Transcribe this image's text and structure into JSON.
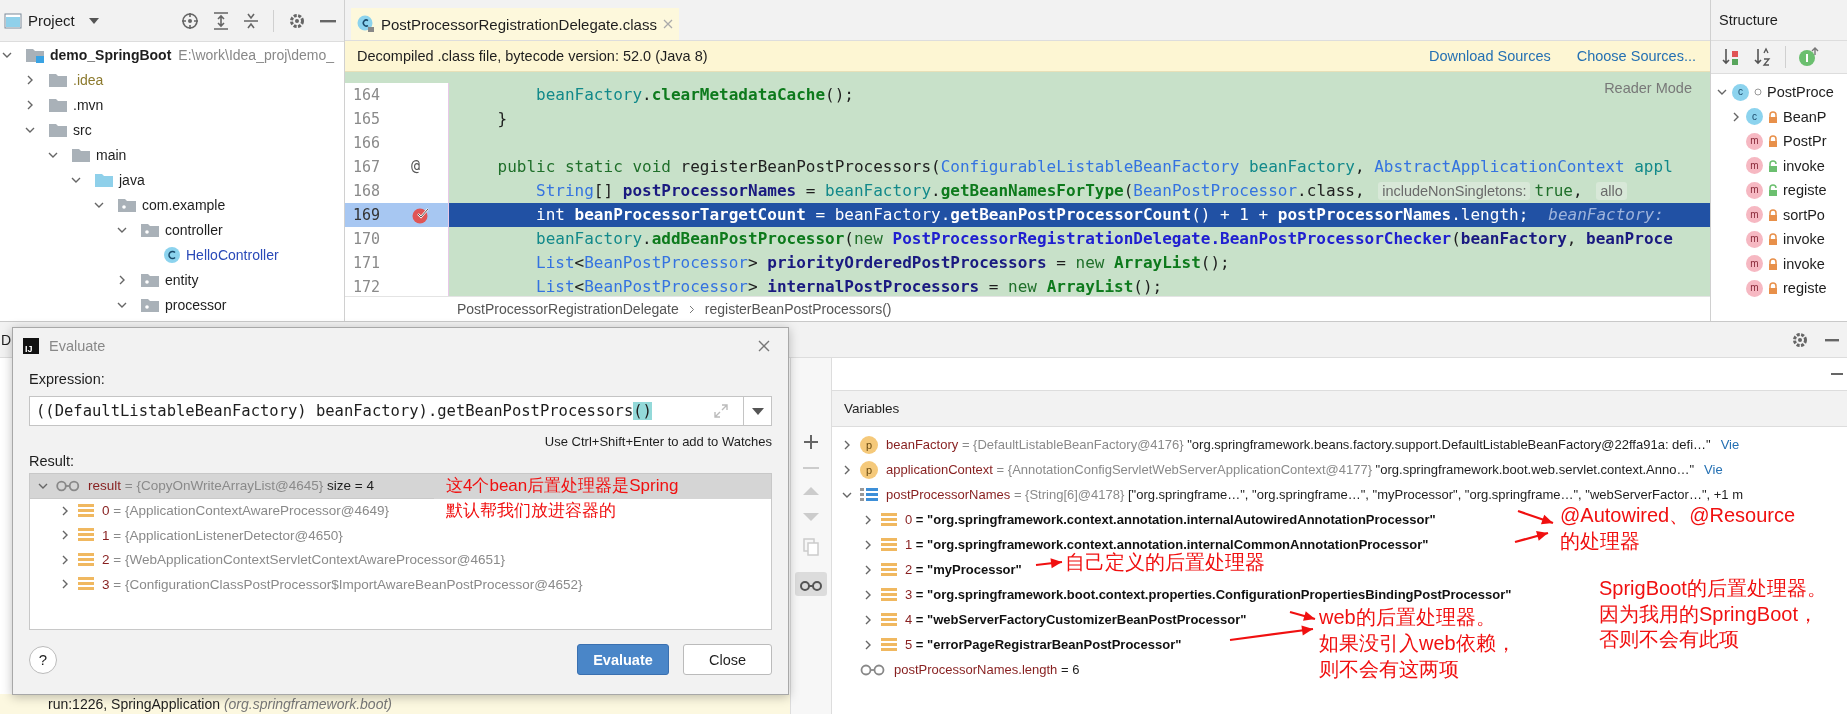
{
  "project_panel": {
    "title": "Project",
    "tree": [
      {
        "label": "demo_SpringBoot",
        "path": "E:\\work\\Idea_proj\\demo_",
        "kind": "module",
        "expanded": true,
        "children": [
          {
            "label": ".idea",
            "kind": "excluded",
            "expanded": false
          },
          {
            "label": ".mvn",
            "kind": "folder",
            "expanded": false
          },
          {
            "label": "src",
            "kind": "folder",
            "expanded": true,
            "children": [
              {
                "label": "main",
                "kind": "folder",
                "expanded": true,
                "children": [
                  {
                    "label": "java",
                    "kind": "source",
                    "expanded": true,
                    "children": [
                      {
                        "label": "com.example",
                        "kind": "package",
                        "expanded": true,
                        "children": [
                          {
                            "label": "controller",
                            "kind": "package",
                            "expanded": true,
                            "children": [
                              {
                                "label": "HelloController",
                                "kind": "class"
                              }
                            ]
                          },
                          {
                            "label": "entity",
                            "kind": "package",
                            "expanded": false
                          },
                          {
                            "label": "processor",
                            "kind": "package",
                            "expanded": true
                          }
                        ]
                      }
                    ]
                  }
                ]
              }
            ]
          }
        ]
      }
    ]
  },
  "editor": {
    "tabs": [
      {
        "label": "PostProcessorRegistrationDelegate.class",
        "selected": true
      }
    ],
    "banner": {
      "text": "Decompiled .class file, bytecode version: 52.0 (Java 8)",
      "links": [
        "Download Sources",
        "Choose Sources..."
      ]
    },
    "reader_mode": "Reader Mode",
    "lines": [
      {
        "number": "164",
        "kind": "statement",
        "selected": false,
        "breakpoint": false,
        "tokens": [
          {
            "kind": "field",
            "text": "beanFactory"
          },
          {
            "kind": "plain",
            "text": "."
          },
          {
            "kind": "method",
            "text": "clearMetadataCache"
          },
          {
            "kind": "plain",
            "text": "();"
          }
        ]
      },
      {
        "number": "165",
        "kind": "member",
        "selected": false,
        "breakpoint": false,
        "tokens": [
          {
            "kind": "plain",
            "text": "}"
          }
        ]
      },
      {
        "number": "166",
        "kind": "blank",
        "selected": false,
        "breakpoint": false
      },
      {
        "number": "167",
        "kind": "member",
        "selected": false,
        "breakpoint": false,
        "gutter_text": "@",
        "tokens": [
          {
            "kind": "keyword",
            "text": "public static void "
          },
          {
            "kind": "plain",
            "text": "registerBeanPostProcessors("
          },
          {
            "kind": "type",
            "text": "ConfigurableListableBeanFactory "
          },
          {
            "kind": "field",
            "text": "beanFactory"
          },
          {
            "kind": "plain",
            "text": ", "
          },
          {
            "kind": "type",
            "text": "AbstractApplicationContext "
          },
          {
            "kind": "field",
            "text": "appl"
          }
        ]
      },
      {
        "number": "168",
        "kind": "statement",
        "selected": false,
        "breakpoint": false,
        "tokens": [
          {
            "kind": "type",
            "text": "String"
          },
          {
            "kind": "plain",
            "text": "[] "
          },
          {
            "kind": "variable",
            "text": "postProcessorNames"
          },
          {
            "kind": "plain",
            "text": " = "
          },
          {
            "kind": "field",
            "text": "beanFactory"
          },
          {
            "kind": "plain",
            "text": "."
          },
          {
            "kind": "method",
            "text": "getBeanNamesForType"
          },
          {
            "kind": "plain",
            "text": "("
          },
          {
            "kind": "type",
            "text": "BeanPostProcessor"
          },
          {
            "kind": "plain",
            "text": ".class, "
          },
          {
            "kind": "hint",
            "text": "includeNonSingletons:"
          },
          {
            "kind": "keyword",
            "text": "true"
          },
          {
            "kind": "plain",
            "text": ", "
          },
          {
            "kind": "hint",
            "text": "allo"
          }
        ]
      },
      {
        "number": "169",
        "kind": "statement",
        "selected": true,
        "breakpoint": true,
        "tokens": [
          {
            "kind": "keyword",
            "text": "int "
          },
          {
            "kind": "variable",
            "text": "beanProcessorTargetCount"
          },
          {
            "kind": "plain",
            "text": " = "
          },
          {
            "kind": "field",
            "text": "beanFactory"
          },
          {
            "kind": "plain",
            "text": "."
          },
          {
            "kind": "method",
            "text": "getBeanPostProcessorCount"
          },
          {
            "kind": "plain",
            "text": "() + 1 + "
          },
          {
            "kind": "variable",
            "text": "postProcessorNames"
          },
          {
            "kind": "plain",
            "text": ".length;"
          },
          {
            "kind": "inline",
            "text": "beanFactory:"
          }
        ]
      },
      {
        "number": "170",
        "kind": "statement",
        "selected": false,
        "breakpoint": false,
        "tokens": [
          {
            "kind": "field",
            "text": "beanFactory"
          },
          {
            "kind": "plain",
            "text": "."
          },
          {
            "kind": "method",
            "text": "addBeanPostProcessor"
          },
          {
            "kind": "plain",
            "text": "("
          },
          {
            "kind": "keyword",
            "text": "new "
          },
          {
            "kind": "classref",
            "text": "PostProcessorRegistrationDelegate.BeanPostProcessorChecker"
          },
          {
            "kind": "plain",
            "text": "("
          },
          {
            "kind": "variable",
            "text": "beanFactory"
          },
          {
            "kind": "plain",
            "text": ", "
          },
          {
            "kind": "variable",
            "text": "beanProce"
          }
        ]
      },
      {
        "number": "171",
        "kind": "statement",
        "selected": false,
        "breakpoint": false,
        "tokens": [
          {
            "kind": "type",
            "text": "List"
          },
          {
            "kind": "plain",
            "text": "<"
          },
          {
            "kind": "type",
            "text": "BeanPostProcessor"
          },
          {
            "kind": "plain",
            "text": "> "
          },
          {
            "kind": "variable",
            "text": "priorityOrderedPostProcessors"
          },
          {
            "kind": "plain",
            "text": " = "
          },
          {
            "kind": "keyword",
            "text": "new "
          },
          {
            "kind": "method",
            "text": "ArrayList"
          },
          {
            "kind": "plain",
            "text": "();"
          }
        ]
      },
      {
        "number": "172",
        "kind": "statement",
        "selected": false,
        "breakpoint": false,
        "tokens": [
          {
            "kind": "type",
            "text": "List"
          },
          {
            "kind": "plain",
            "text": "<"
          },
          {
            "kind": "type",
            "text": "BeanPostProcessor"
          },
          {
            "kind": "plain",
            "text": "> "
          },
          {
            "kind": "variable",
            "text": "internalPostProcessors"
          },
          {
            "kind": "plain",
            "text": " = "
          },
          {
            "kind": "keyword",
            "text": "new "
          },
          {
            "kind": "method",
            "text": "ArrayList"
          },
          {
            "kind": "plain",
            "text": "();"
          }
        ]
      }
    ],
    "breadcrumb": [
      "PostProcessorRegistrationDelegate",
      "registerBeanPostProcessors()"
    ]
  },
  "structure_panel": {
    "title": "Structure",
    "tree": [
      {
        "label": "PostProce",
        "icon": "c",
        "expanded": true,
        "children": [
          {
            "label": "BeanP",
            "icon": "c",
            "private": true,
            "expanded": false
          },
          {
            "label": "PostPr",
            "icon": "m",
            "private": true
          },
          {
            "label": "invoke",
            "icon": "m",
            "private": false
          },
          {
            "label": "registe",
            "icon": "m",
            "private": false
          },
          {
            "label": "sortPo",
            "icon": "m",
            "private": true
          },
          {
            "label": "invoke",
            "icon": "m",
            "private": true
          },
          {
            "label": "invoke",
            "icon": "m",
            "private": true
          },
          {
            "label": "registe",
            "icon": "m",
            "private": true
          }
        ]
      }
    ]
  },
  "debug_panel": {
    "tab": "D",
    "frame": {
      "text": "run:1226, SpringApplication",
      "package": "(org.springframework.boot)"
    }
  },
  "evaluate_dialog": {
    "app_icon": "IJ",
    "title": "Evaluate",
    "expression_label": "Expression:",
    "expression": "((DefaultListableBeanFactory) beanFactory).getBeanPostProcessors()",
    "bracket_highlight": true,
    "watch_hint": "Use Ctrl+Shift+Enter to add to Watches",
    "result_label": "Result:",
    "result": {
      "name": "result",
      "detail": "= {CopyOnWriteArrayList@4645}",
      "extra": "size = 4",
      "expanded": true,
      "selected": true,
      "children": [
        {
          "name": "0",
          "detail": "= {ApplicationContextAwareProcessor@4649}",
          "expanded": false,
          "selected": false
        },
        {
          "name": "1",
          "detail": "= {ApplicationListenerDetector@4650}",
          "expanded": false,
          "selected": false
        },
        {
          "name": "2",
          "detail": "= {WebApplicationContextServletContextAwareProcessor@4651}",
          "expanded": false,
          "selected": false
        },
        {
          "name": "3",
          "detail": "= {ConfigurationClassPostProcessor$ImportAwareBeanPostProcessor@4652}",
          "expanded": false,
          "selected": false
        }
      ]
    },
    "note_lines": [
      "这4个bean后置处理器是Spring",
      "默认帮我们放进容器的"
    ],
    "help": "?",
    "buttons": [
      {
        "label": "Evaluate",
        "kind": "primary"
      },
      {
        "label": "Close",
        "kind": "secondary"
      }
    ]
  },
  "variables_panel": {
    "title": "Variables",
    "rows": [
      {
        "kind": "parameter",
        "icon": "p",
        "name": "beanFactory",
        "expanded": false,
        "type": "= {DefaultListableBeanFactory@4176}",
        "value": "\"org.springframework.beans.factory.support.DefaultListableBeanFactory@22ffa91a: defi…\"",
        "link": "Vie"
      },
      {
        "kind": "parameter",
        "icon": "p",
        "name": "applicationContext",
        "expanded": false,
        "type": "= {AnnotationConfigServletWebServerApplicationContext@4177}",
        "value": "\"org.springframework.boot.web.servlet.context.Anno…\"",
        "link": "Vie"
      },
      {
        "kind": "array",
        "name": "postProcessorNames",
        "expanded": true,
        "type": "= {String[6]@4178}",
        "value": "[\"org.springframe…\", \"org.springframe…\", \"myProcessor\", \"org.springframe…\", \"webServerFactor…\", +1 m",
        "children": [
          {
            "name": "0",
            "value": "= \"org.springframework.context.annotation.internalAutowiredAnnotationProcessor\"",
            "expanded": false
          },
          {
            "name": "1",
            "value": "= \"org.springframework.context.annotation.internalCommonAnnotationProcessor\"",
            "expanded": false
          },
          {
            "name": "2",
            "value": "= \"myProcessor\"",
            "expanded": false
          },
          {
            "name": "3",
            "value": "= \"org.springframework.boot.context.properties.ConfigurationPropertiesBindingPostProcessor\"",
            "expanded": false
          },
          {
            "name": "4",
            "value": "= \"webServerFactoryCustomizerBeanPostProcessor\"",
            "expanded": false
          },
          {
            "name": "5",
            "value": "= \"errorPageRegistrarBeanPostProcessor\"",
            "expanded": false
          }
        ]
      },
      {
        "kind": "watch",
        "name": "postProcessorNames.length",
        "value": "= 6"
      }
    ],
    "notes": [
      {
        "lines": [
          "@Autowired、@Resource",
          "的处理器"
        ]
      },
      {
        "lines": [
          "自己定义的后置处理器"
        ]
      },
      {
        "lines": [
          "SprigBoot的后置处理器。",
          "因为我用的SpringBoot，",
          "否则不会有此项"
        ]
      },
      {
        "lines": [
          "web的后置处理器。",
          "如果没引入web依赖，",
          "则不会有这两项"
        ]
      }
    ]
  }
}
